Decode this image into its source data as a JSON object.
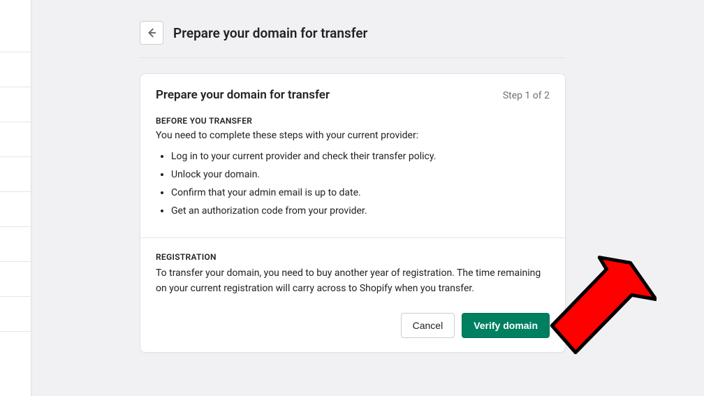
{
  "header": {
    "title": "Prepare your domain for transfer"
  },
  "card": {
    "title": "Prepare your domain for transfer",
    "step": "Step 1 of 2",
    "before": {
      "label": "BEFORE YOU TRANSFER",
      "intro": "You need to complete these steps with your current provider:",
      "items": [
        "Log in to your current provider and check their transfer policy.",
        "Unlock your domain.",
        "Confirm that your admin email is up to date.",
        "Get an authorization code from your provider."
      ]
    },
    "registration": {
      "label": "REGISTRATION",
      "text": "To transfer your domain, you need to buy another year of registration. The time remaining on your current registration will carry across to Shopify when you transfer."
    },
    "buttons": {
      "cancel": "Cancel",
      "verify": "Verify domain"
    }
  }
}
